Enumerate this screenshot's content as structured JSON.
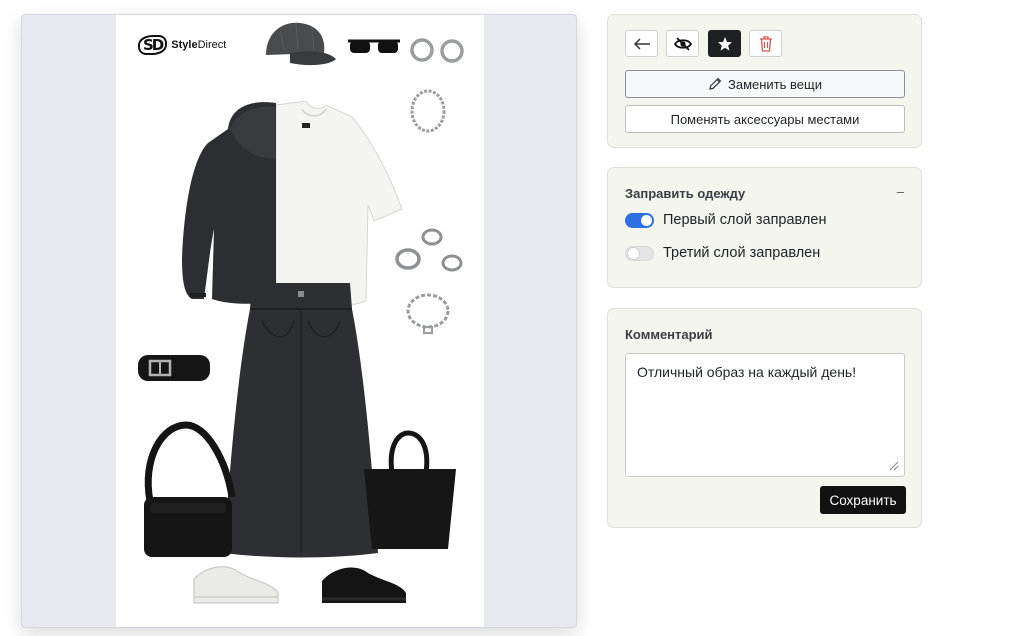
{
  "board": {
    "brand": {
      "mark": "SD",
      "name_bold": "Style",
      "name_rest": "Direct"
    },
    "items": [
      "cap-icon",
      "sunglasses-icon",
      "hoop-earrings-icon",
      "chain-necklace-icon",
      "hoodie-icon",
      "tshirt-icon",
      "rings-icon",
      "chain-bracelet-icon",
      "belt-icon",
      "denim-skirt-icon",
      "crossbody-bag-icon",
      "tote-bag-icon",
      "white-sneaker-icon",
      "black-sneaker-icon"
    ]
  },
  "toolbar": {
    "icons": [
      "arrow-left-icon",
      "eye-off-icon",
      "star-icon",
      "trash-icon"
    ],
    "replace_label": "Заменить вещи",
    "swap_label": "Поменять аксессуары местами"
  },
  "tuck": {
    "title": "Заправить одежду",
    "collapse": "–",
    "toggles": [
      {
        "label": "Первый слой заправлен",
        "on": true
      },
      {
        "label": "Третий слой заправлен",
        "on": false
      }
    ]
  },
  "comment": {
    "title": "Комментарий",
    "value": "Отличный образ на каждый день!",
    "save_label": "Сохранить"
  },
  "colors": {
    "accent": "#2f6fe4",
    "danger": "#d9534f",
    "dark": "#1e2024"
  }
}
